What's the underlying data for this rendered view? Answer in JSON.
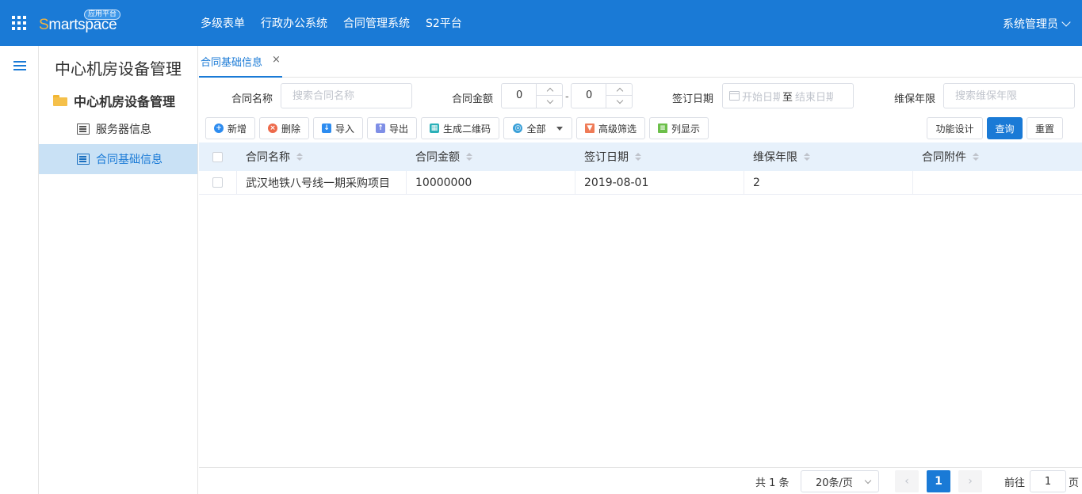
{
  "header": {
    "logo_text_first": "S",
    "logo_text_rest": "martspace",
    "logo_badge": "应用平台",
    "nav": [
      "多级表单",
      "行政办公系统",
      "合同管理系统",
      "S2平台"
    ],
    "user": "系统管理员"
  },
  "sidebar": {
    "title": "中心机房设备管理",
    "group": "中心机房设备管理",
    "items": [
      {
        "label": "服务器信息",
        "active": false
      },
      {
        "label": "合同基础信息",
        "active": true
      }
    ]
  },
  "tabs": [
    {
      "label": "合同基础信息",
      "close": "×"
    }
  ],
  "filters": {
    "name_label": "合同名称",
    "name_placeholder": "搜索合同名称",
    "amount_label": "合同金额",
    "amount_min": "0",
    "amount_max": "0",
    "amount_sep": "-",
    "date_label": "签订日期",
    "date_start_placeholder": "开始日期",
    "date_sep": "至",
    "date_end_placeholder": "结束日期",
    "years_label": "维保年限",
    "years_placeholder": "搜索维保年限"
  },
  "toolbar": {
    "add": "新增",
    "delete": "删除",
    "import": "导入",
    "export": "导出",
    "qrcode": "生成二维码",
    "all": "全部",
    "advanced": "高级筛选",
    "columns": "列显示",
    "design": "功能设计",
    "query": "查询",
    "reset": "重置"
  },
  "table": {
    "columns": [
      "合同名称",
      "合同金额",
      "签订日期",
      "维保年限",
      "合同附件"
    ],
    "rows": [
      [
        "武汉地铁八号线一期采购项目",
        "10000000",
        "2019-08-01",
        "2",
        ""
      ]
    ]
  },
  "pager": {
    "total": "共 1 条",
    "page_size": "20条/页",
    "prev": "‹",
    "current": "1",
    "next": "›",
    "goto_label": "前往",
    "goto_value": "1",
    "goto_unit": "页"
  },
  "colors": {
    "primary": "#1a7ad6",
    "header_row": "#e7f1fb",
    "active_item": "#c9e1f5"
  }
}
